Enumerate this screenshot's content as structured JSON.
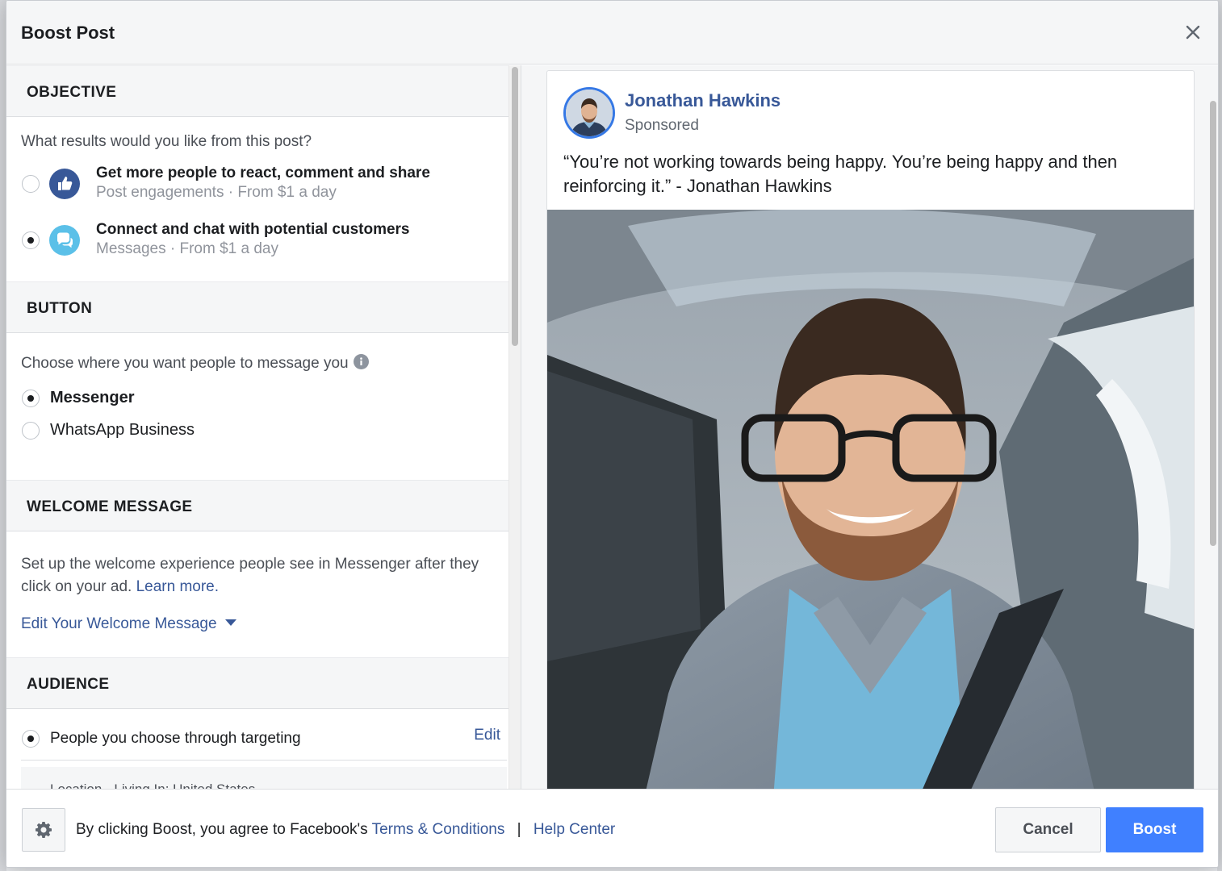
{
  "modal": {
    "title": "Boost Post"
  },
  "objective": {
    "header": "OBJECTIVE",
    "question": "What results would you like from this post?",
    "options": [
      {
        "title": "Get more people to react, comment and share",
        "subtitle": "Post engagements · From $1 a day",
        "icon": "thumbs-up-icon",
        "selected": false
      },
      {
        "title": "Connect and chat with potential customers",
        "subtitle": "Messages · From $1 a day",
        "icon": "chat-bubbles-icon",
        "selected": true
      }
    ]
  },
  "button_section": {
    "header": "BUTTON",
    "question": "Choose where you want people to message you",
    "options": [
      {
        "label": "Messenger",
        "selected": true
      },
      {
        "label": "WhatsApp Business",
        "selected": false
      }
    ]
  },
  "welcome": {
    "header": "WELCOME MESSAGE",
    "description": "Set up the welcome experience people see in Messenger after they click on your ad.",
    "learn_more": "Learn more.",
    "edit_label": "Edit Your Welcome Message"
  },
  "audience": {
    "header": "AUDIENCE",
    "option_label": "People you choose through targeting",
    "edit_label": "Edit",
    "detail_partial": "Location - Living In: United States"
  },
  "post": {
    "author": "Jonathan Hawkins",
    "sponsored": "Sponsored",
    "text": "“You’re not working towards being happy. You’re being happy and then reinforcing it.” - Jonathan Hawkins"
  },
  "footer": {
    "agree_text": "By clicking Boost, you agree to Facebook's",
    "terms_link": "Terms & Conditions",
    "separator": "|",
    "help_link": "Help Center",
    "cancel_label": "Cancel",
    "boost_label": "Boost"
  },
  "colors": {
    "link": "#385898",
    "primary": "#4080ff",
    "messenger": "#5bc0e8"
  }
}
